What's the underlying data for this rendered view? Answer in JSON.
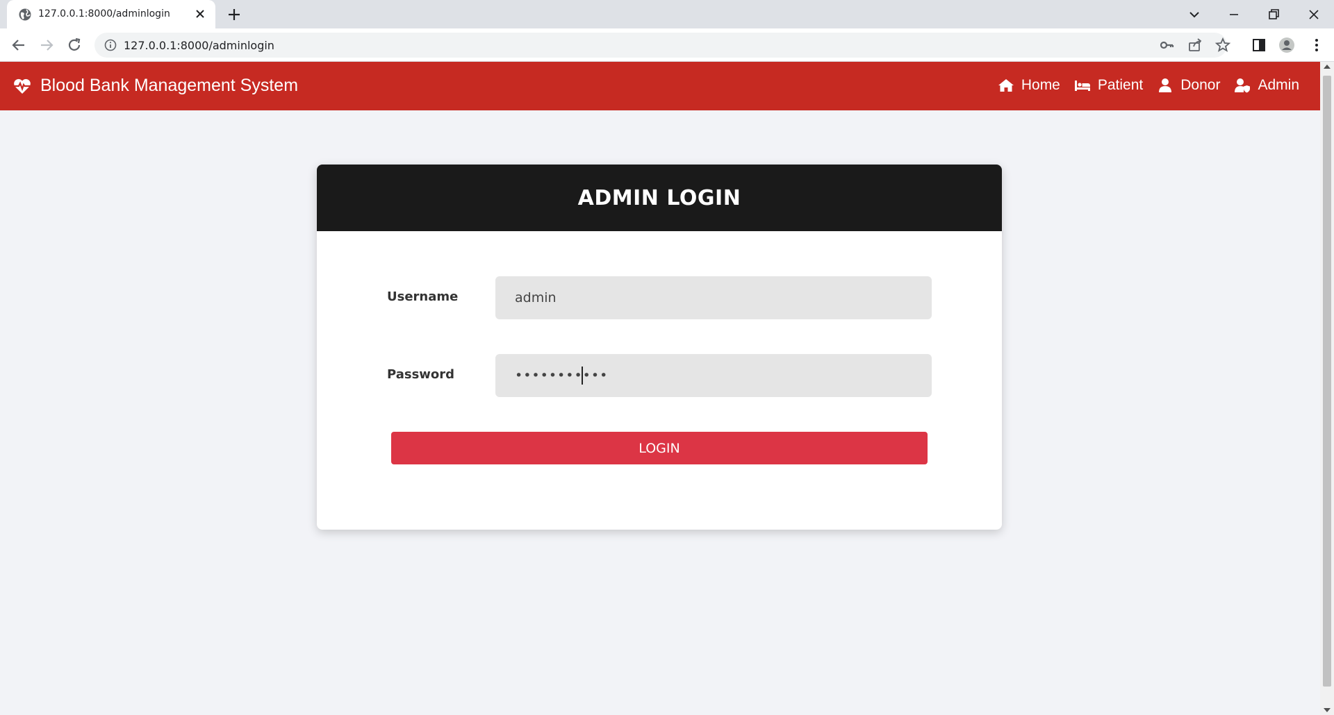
{
  "browser": {
    "tab_title": "127.0.0.1:8000/adminlogin",
    "url": "127.0.0.1:8000/adminlogin"
  },
  "navbar": {
    "brand": "Blood Bank Management System",
    "links": [
      {
        "label": "Home",
        "icon": "home-icon"
      },
      {
        "label": "Patient",
        "icon": "bed-icon"
      },
      {
        "label": "Donor",
        "icon": "user-icon"
      },
      {
        "label": "Admin",
        "icon": "user-shield-icon"
      }
    ]
  },
  "login_card": {
    "title": "ADMIN LOGIN",
    "username_label": "Username",
    "username_value": "admin",
    "password_label": "Password",
    "password_value": "admin123456",
    "login_button": "LOGIN"
  },
  "colors": {
    "navbar": "#c62a22",
    "card_header": "#1a1a1a",
    "button": "#dc3545",
    "page_bg": "#f2f3f7"
  }
}
